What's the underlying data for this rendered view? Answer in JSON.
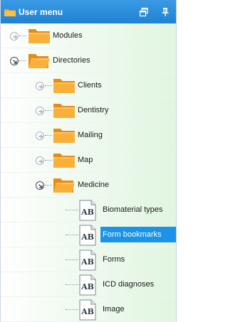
{
  "header": {
    "title": "User menu",
    "title_icon": "folder-icon",
    "restore_icon": "restore-window-icon",
    "pin_icon": "pin-icon"
  },
  "tree": {
    "nodes": [
      {
        "label": "Modules",
        "level": 0,
        "type": "folder",
        "state": "collapsed"
      },
      {
        "label": "Directories",
        "level": 0,
        "type": "folder",
        "state": "expanded"
      },
      {
        "label": "Clients",
        "level": 1,
        "type": "folder",
        "state": "collapsed"
      },
      {
        "label": "Dentistry",
        "level": 1,
        "type": "folder",
        "state": "collapsed"
      },
      {
        "label": "Mailing",
        "level": 1,
        "type": "folder",
        "state": "collapsed"
      },
      {
        "label": "Map",
        "level": 1,
        "type": "folder",
        "state": "collapsed"
      },
      {
        "label": "Medicine",
        "level": 1,
        "type": "folder",
        "state": "expanded"
      },
      {
        "label": "Biomaterial types",
        "level": 2,
        "type": "form",
        "icon_text": "AB"
      },
      {
        "label": "Form bookmarks",
        "level": 2,
        "type": "form",
        "icon_text": "AB",
        "selected": true
      },
      {
        "label": "Forms",
        "level": 2,
        "type": "form",
        "icon_text": "AB"
      },
      {
        "label": "ICD diagnoses",
        "level": 2,
        "type": "form",
        "icon_text": "AB"
      },
      {
        "label": "Image",
        "level": 2,
        "type": "form",
        "icon_text": "AB"
      }
    ]
  },
  "colors": {
    "header": "#2a8ddc",
    "selection": "#1a93e8",
    "folder": "#f5a623",
    "row_tint": "#e1f5e1"
  }
}
